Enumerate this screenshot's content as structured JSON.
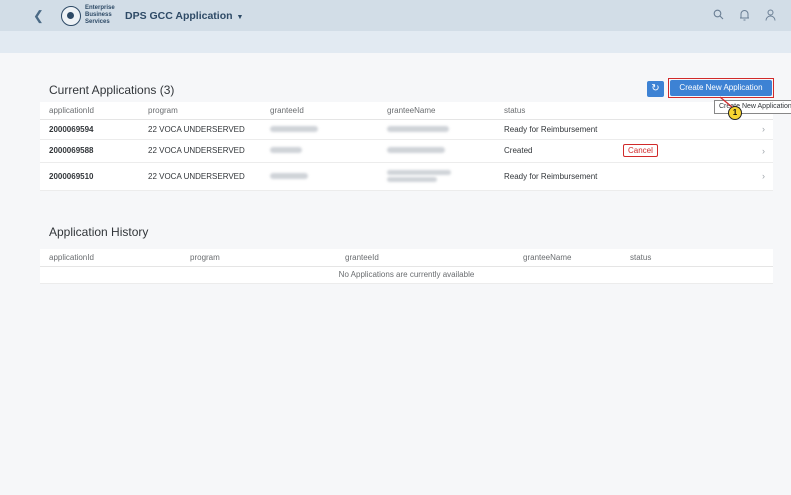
{
  "header": {
    "brand_line1": "Enterprise",
    "brand_line2": "Business",
    "brand_line3": "Services",
    "app_title": "DPS GCC Application",
    "icons": [
      "back-icon",
      "search-icon",
      "bell-icon",
      "user-icon"
    ]
  },
  "current": {
    "title": "Current Applications (3)",
    "create_label": "Create New Application",
    "tooltip": "Create New Application",
    "step": "1",
    "columns": [
      "applicationId",
      "program",
      "granteeId",
      "granteeName",
      "status"
    ],
    "rows": [
      {
        "applicationId": "2000069594",
        "program": "22 VOCA UNDERSERVED",
        "status": "Ready for Reimbursement"
      },
      {
        "applicationId": "2000069588",
        "program": "22 VOCA UNDERSERVED",
        "status": "Created",
        "action": "Cancel"
      },
      {
        "applicationId": "2000069510",
        "program": "22 VOCA UNDERSERVED",
        "status": "Ready for Reimbursement"
      }
    ]
  },
  "history": {
    "title": "Application History",
    "columns": [
      "applicationId",
      "program",
      "granteeId",
      "granteeName",
      "status"
    ],
    "empty_message": "No Applications are currently available"
  },
  "colors": {
    "accent": "#3d82d4",
    "highlight": "#d12a2a",
    "shellbar": "#d2dde7"
  }
}
